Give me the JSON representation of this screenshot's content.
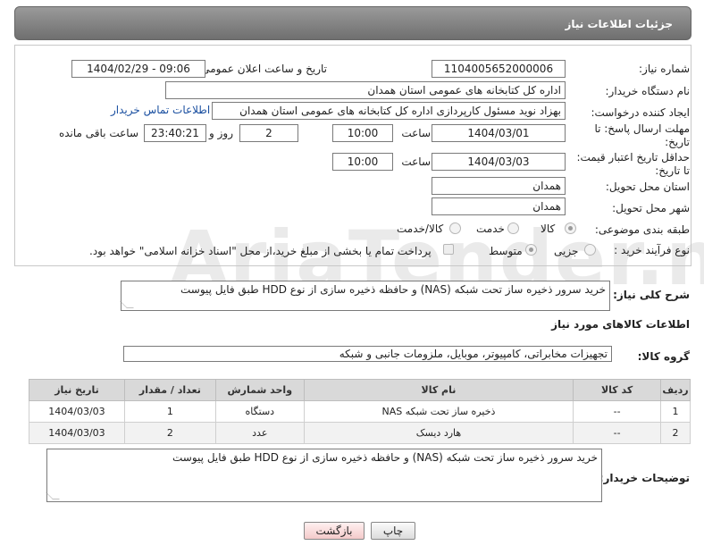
{
  "watermark": "AriaTender.net",
  "panel_title": "جزئیات اطلاعات نیاز",
  "fields": {
    "need_number_label": "شماره نیاز:",
    "need_number": "1104005652000006",
    "announce_label": "تاریخ و ساعت اعلان عمومی:",
    "announce_value": "1404/02/29 - 09:06",
    "buyer_org_label": "نام دستگاه خریدار:",
    "buyer_org": "اداره کل کتابخانه های عمومی استان همدان",
    "creator_label": "ایجاد کننده درخواست:",
    "creator": "بهزاد نوید مسئول کارپردازی اداره کل کتابخانه های عمومی استان همدان",
    "contact_link": "اطلاعات تماس خریدار",
    "reply_deadline_label": "مهلت ارسال پاسخ: تا تاریخ:",
    "reply_date": "1404/03/01",
    "time_label": "ساعت",
    "reply_time": "10:00",
    "days_value": "2",
    "days_label": "روز و",
    "remaining_time": "23:40:21",
    "remaining_label": "ساعت باقی مانده",
    "price_validity_label": "حداقل تاریخ اعتبار قیمت: تا تاریخ:",
    "price_date": "1404/03/03",
    "price_time": "10:00",
    "province_label": "استان محل تحویل:",
    "province": "همدان",
    "city_label": "شهر محل تحویل:",
    "city": "همدان",
    "category_label": "طبقه بندی موضوعی:",
    "category_options": [
      "کالا",
      "خدمت",
      "کالا/خدمت"
    ],
    "process_label": "نوع فرآیند خرید :",
    "process_options": [
      "جزیی",
      "متوسط"
    ],
    "payment_note": "پرداخت تمام یا بخشی از مبلغ خرید،از محل \"اسناد خزانه اسلامی\" خواهد بود."
  },
  "summary_label": "شرح کلی نیاز:",
  "summary": "خرید سرور ذخیره ساز تحت شبکه (NAS) و حافظه ذخیره سازی از نوع HDD طبق فایل پیوست",
  "goods_header": "اطلاعات کالاهای مورد نیاز",
  "goods_group_label": "گروه کالا:",
  "goods_group": "تجهیزات مخابراتی، کامپیوتر، موبایل، ملزومات جانبی و شبکه",
  "table": {
    "headers": [
      "ردیف",
      "کد کالا",
      "نام کالا",
      "واحد شمارش",
      "تعداد / مقدار",
      "تاریخ نیاز"
    ],
    "rows": [
      [
        "1",
        "--",
        "ذخیره ساز تحت شبکه NAS",
        "دستگاه",
        "1",
        "1404/03/03"
      ],
      [
        "2",
        "--",
        "هارد دیسک",
        "عدد",
        "2",
        "1404/03/03"
      ]
    ]
  },
  "buyer_notes_label": "توضیحات خریدار:",
  "buyer_notes": "خرید سرور ذخیره ساز تحت شبکه (NAS) و حافظه ذخیره سازی از نوع HDD طبق فایل پیوست",
  "buttons": {
    "print": "چاپ",
    "back": "بازگشت"
  }
}
